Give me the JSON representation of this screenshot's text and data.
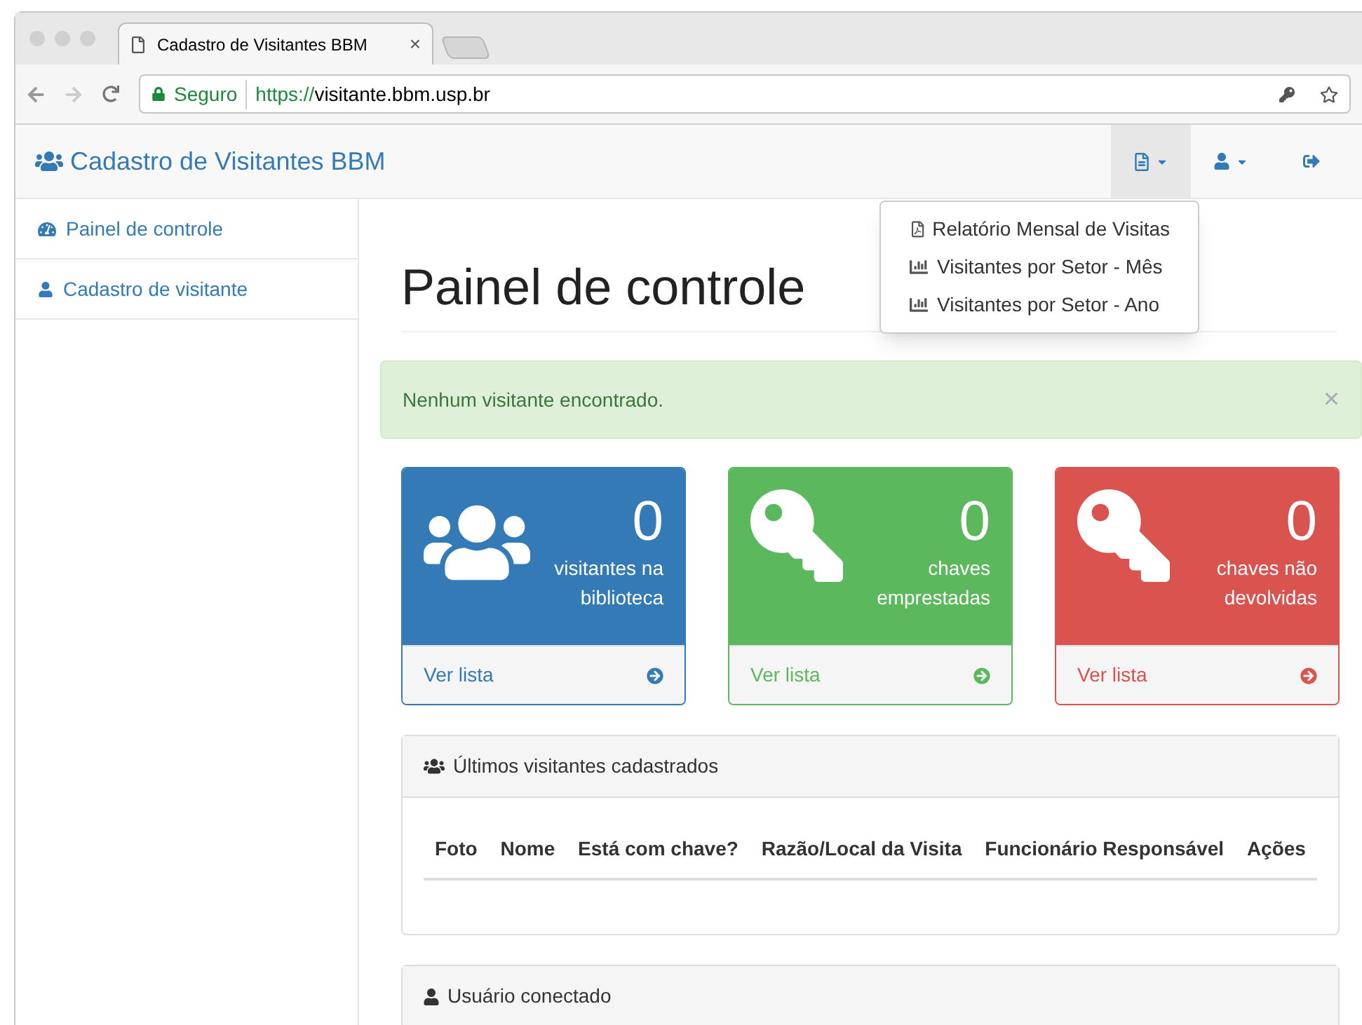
{
  "browser": {
    "tab_title": "Cadastro de Visitantes BBM",
    "tab_close": "×",
    "secure_label": "Seguro",
    "url_scheme": "https://",
    "url_host": "visitante.bbm.usp.br"
  },
  "navbar": {
    "brand": "Cadastro de Visitantes BBM",
    "menus": [
      {
        "kind": "report",
        "expanded": true
      },
      {
        "kind": "user",
        "expanded": false
      },
      {
        "kind": "logout",
        "expanded": false
      }
    ],
    "dropdown": [
      {
        "kind": "pdf",
        "label": "Relatório Mensal de Visitas"
      },
      {
        "kind": "chart",
        "label": "Visitantes por Setor - Mês"
      },
      {
        "kind": "chart",
        "label": "Visitantes por Setor - Ano"
      }
    ]
  },
  "sidebar": {
    "items": [
      {
        "kind": "dashboard",
        "label": "Painel de controle"
      },
      {
        "kind": "user",
        "label": "Cadastro de visitante"
      }
    ]
  },
  "page_title": "Painel de controle",
  "alert": {
    "message": "Nenhum visitante encontrado.",
    "dismiss": "×"
  },
  "cards": [
    {
      "kind": "visitors",
      "color": "#337ab7",
      "count": "0",
      "caption": [
        "visitantes na",
        "biblioteca"
      ],
      "link": "Ver lista"
    },
    {
      "kind": "key",
      "color": "#5cb85c",
      "count": "0",
      "caption": [
        "chaves",
        "emprestadas"
      ],
      "link": "Ver lista"
    },
    {
      "kind": "key",
      "color": "#d9534f",
      "count": "0",
      "caption": [
        "chaves não",
        "devolvidas"
      ],
      "link": "Ver lista"
    }
  ],
  "panels": [
    {
      "kind": "users",
      "title": "Últimos visitantes cadastrados",
      "columns": [
        "Foto",
        "Nome",
        "Está com chave?",
        "Razão/Local da Visita",
        "Funcionário Responsável",
        "Ações"
      ]
    },
    {
      "kind": "user",
      "title": "Usuário conectado"
    }
  ]
}
